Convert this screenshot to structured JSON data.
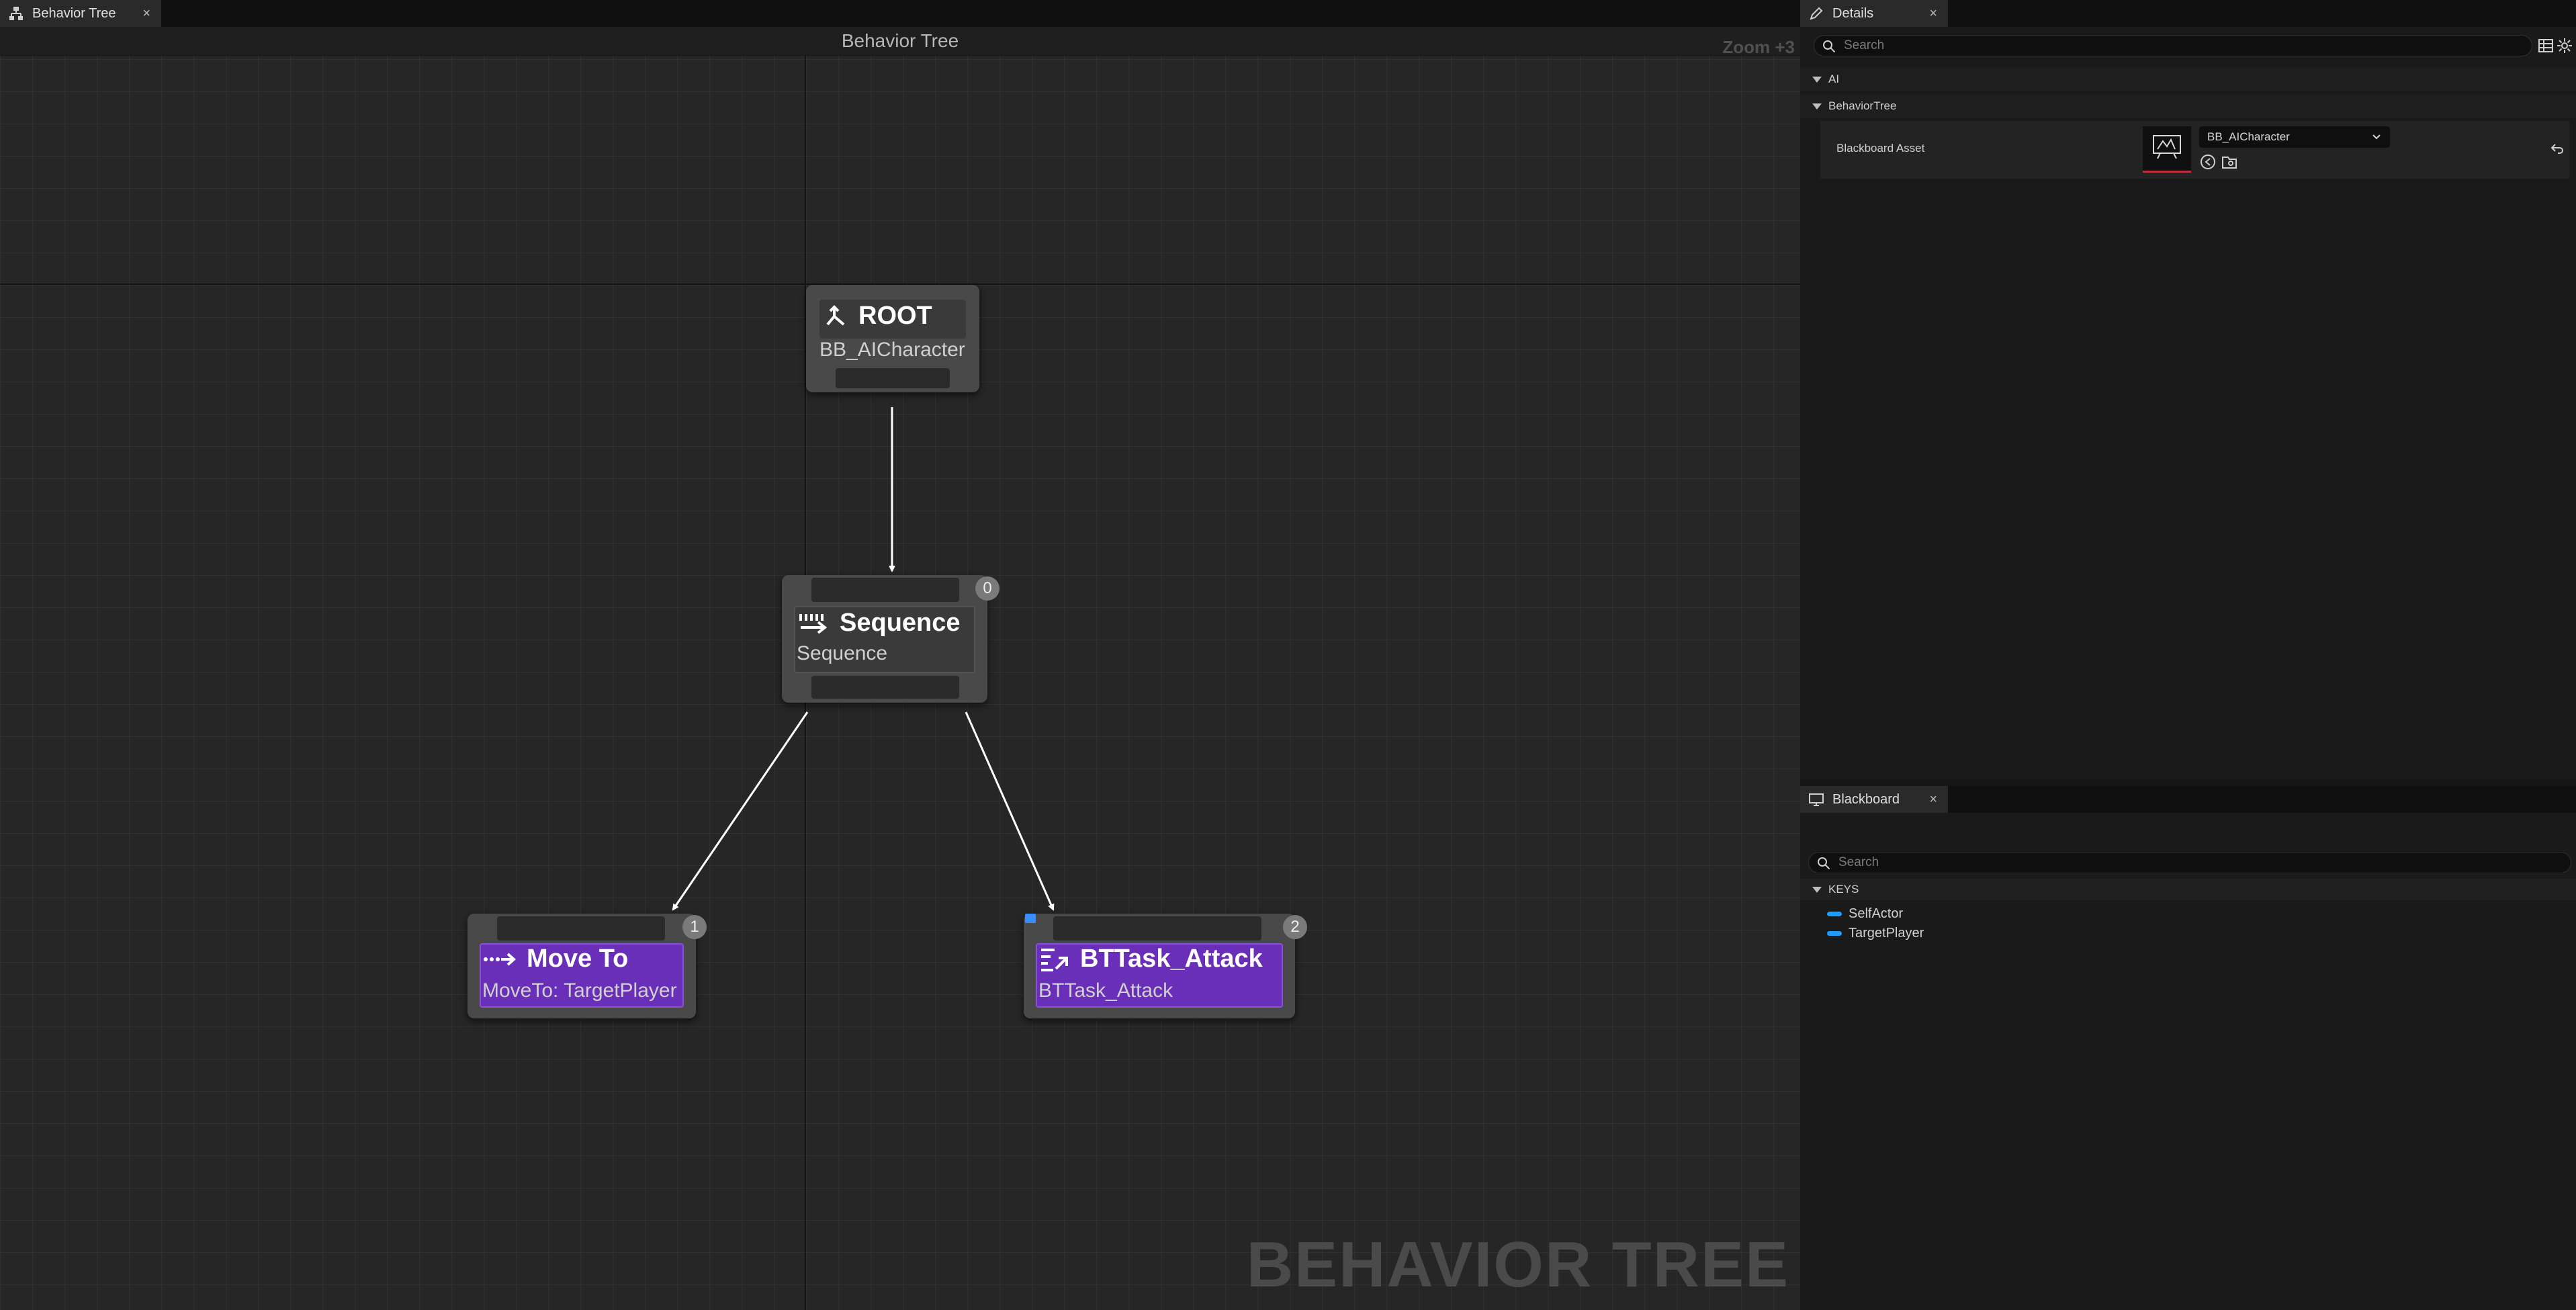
{
  "graph_tab": {
    "label": "Behavior Tree",
    "close": "×"
  },
  "graph": {
    "title": "Behavior Tree",
    "zoom": "Zoom +3",
    "watermark": "BEHAVIOR TREE"
  },
  "nodes": {
    "root": {
      "title": "ROOT",
      "subtitle": "BB_AICharacter"
    },
    "sequence": {
      "title": "Sequence",
      "subtitle": "Sequence",
      "index": "0"
    },
    "move_to": {
      "title": "Move To",
      "subtitle": "MoveTo: TargetPlayer",
      "index": "1"
    },
    "attack": {
      "title": "BTTask_Attack",
      "subtitle": "BTTask_Attack",
      "index": "2"
    }
  },
  "colors": {
    "task_purple": "#6a2fb8",
    "task_purple_border": "#8a52d6",
    "key_blue": "#1f9bff",
    "canvas": "#262626"
  },
  "details": {
    "tab_label": "Details",
    "close": "×",
    "search_placeholder": "Search",
    "sections": {
      "ai": "AI",
      "behavior_tree": "BehaviorTree"
    },
    "property": {
      "label": "Blackboard Asset",
      "value": "BB_AICharacter"
    }
  },
  "blackboard": {
    "tab_label": "Blackboard",
    "close": "×",
    "search_placeholder": "Search",
    "keys_header": "KEYS",
    "keys": [
      "SelfActor",
      "TargetPlayer"
    ]
  },
  "icons": [
    "behavior-tree-icon",
    "pencil-icon",
    "search-icon",
    "grid-view-icon",
    "settings-icon",
    "monitor-icon",
    "root-icon",
    "sequence-icon",
    "move-to-icon",
    "task-icon",
    "reset-arrow-icon",
    "browse-icon",
    "open-asset-icon",
    "chevron-down-icon"
  ]
}
